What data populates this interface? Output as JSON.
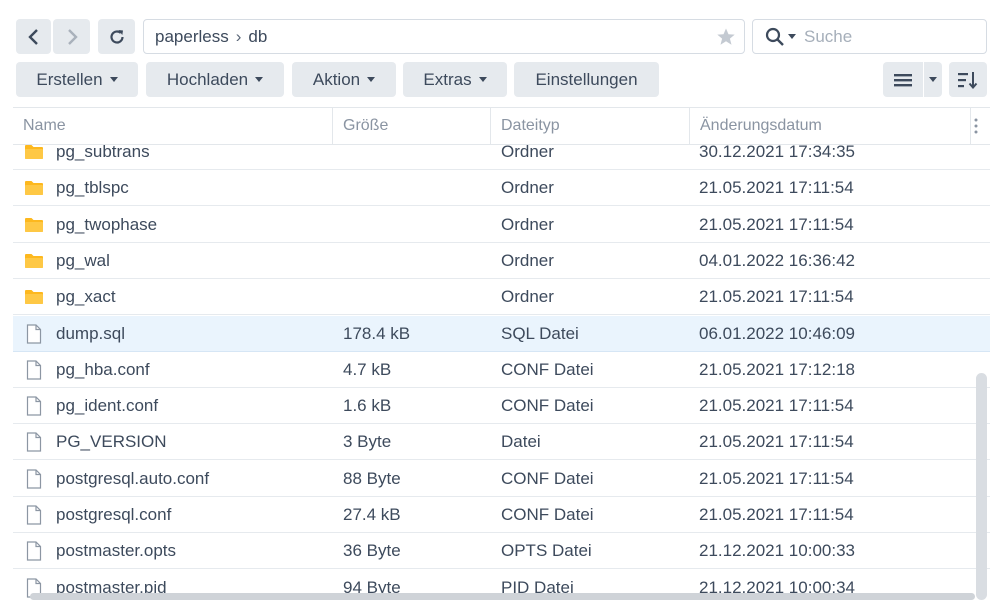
{
  "nav": {
    "back": "back",
    "forward": "forward",
    "refresh": "refresh"
  },
  "address": {
    "segments": [
      "paperless",
      "db"
    ]
  },
  "search": {
    "placeholder": "Suche"
  },
  "toolbar": {
    "create_label": "Erstellen",
    "upload_label": "Hochladen",
    "action_label": "Aktion",
    "extras_label": "Extras",
    "settings_label": "Einstellungen"
  },
  "columns": {
    "name": "Name",
    "size": "Größe",
    "type": "Dateityp",
    "modified": "Änderungsdatum"
  },
  "files": [
    {
      "name": "pg_subtrans",
      "size": "",
      "type": "Ordner",
      "modified": "30.12.2021 17:34:35",
      "kind": "folder"
    },
    {
      "name": "pg_tblspc",
      "size": "",
      "type": "Ordner",
      "modified": "21.05.2021 17:11:54",
      "kind": "folder"
    },
    {
      "name": "pg_twophase",
      "size": "",
      "type": "Ordner",
      "modified": "21.05.2021 17:11:54",
      "kind": "folder"
    },
    {
      "name": "pg_wal",
      "size": "",
      "type": "Ordner",
      "modified": "04.01.2022 16:36:42",
      "kind": "folder"
    },
    {
      "name": "pg_xact",
      "size": "",
      "type": "Ordner",
      "modified": "21.05.2021 17:11:54",
      "kind": "folder"
    },
    {
      "name": "dump.sql",
      "size": "178.4 kB",
      "type": "SQL Datei",
      "modified": "06.01.2022 10:46:09",
      "kind": "file",
      "selected": true
    },
    {
      "name": "pg_hba.conf",
      "size": "4.7 kB",
      "type": "CONF Datei",
      "modified": "21.05.2021 17:12:18",
      "kind": "file"
    },
    {
      "name": "pg_ident.conf",
      "size": "1.6 kB",
      "type": "CONF Datei",
      "modified": "21.05.2021 17:11:54",
      "kind": "file"
    },
    {
      "name": "PG_VERSION",
      "size": "3 Byte",
      "type": "Datei",
      "modified": "21.05.2021 17:11:54",
      "kind": "file"
    },
    {
      "name": "postgresql.auto.conf",
      "size": "88 Byte",
      "type": "CONF Datei",
      "modified": "21.05.2021 17:11:54",
      "kind": "file"
    },
    {
      "name": "postgresql.conf",
      "size": "27.4 kB",
      "type": "CONF Datei",
      "modified": "21.05.2021 17:11:54",
      "kind": "file"
    },
    {
      "name": "postmaster.opts",
      "size": "36 Byte",
      "type": "OPTS Datei",
      "modified": "21.12.2021 10:00:33",
      "kind": "file"
    },
    {
      "name": "postmaster.pid",
      "size": "94 Byte",
      "type": "PID Datei",
      "modified": "21.12.2021 10:00:34",
      "kind": "file"
    }
  ],
  "colors": {
    "folder": "#fdb81e",
    "selected_row": "#eaf4fd",
    "button_bg": "#e6eaee"
  }
}
